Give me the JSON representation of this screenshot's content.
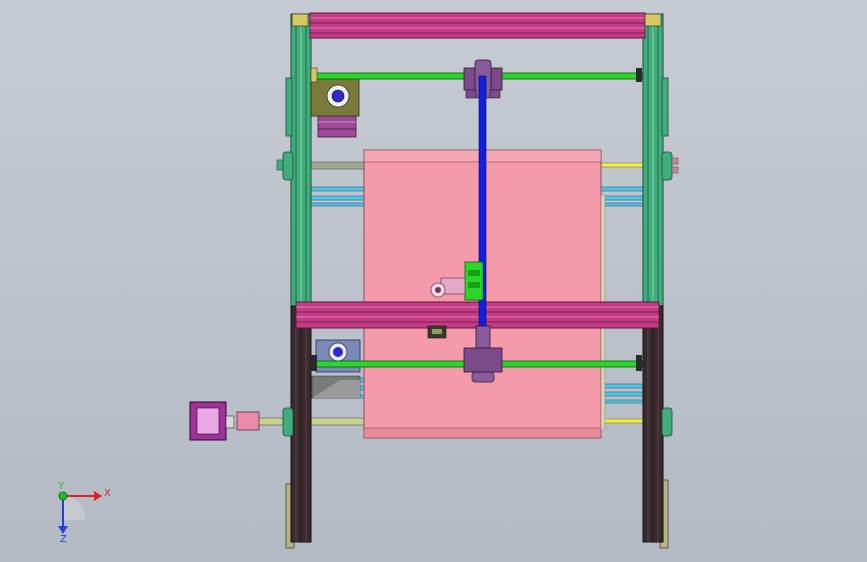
{
  "triad": {
    "x_label": "X",
    "y_label": "Y",
    "z_label": "Z",
    "x_color": "#e02020",
    "y_color": "#20c020",
    "z_color": "#2040e0"
  },
  "colors": {
    "background_top": "#c6cbd3",
    "background_bottom": "#b4bac4",
    "frame_green": "#3fae7c",
    "frame_dark": "#3a2a2e",
    "rail_magenta": "#c43c86",
    "rod_green": "#2ad62a",
    "belt_blue": "#1020e0",
    "bed_pink": "#f59aaa",
    "cyan_rail": "#4fc8e8",
    "motor_olive": "#7a7a3a",
    "motor_violet": "#a04a9a"
  }
}
